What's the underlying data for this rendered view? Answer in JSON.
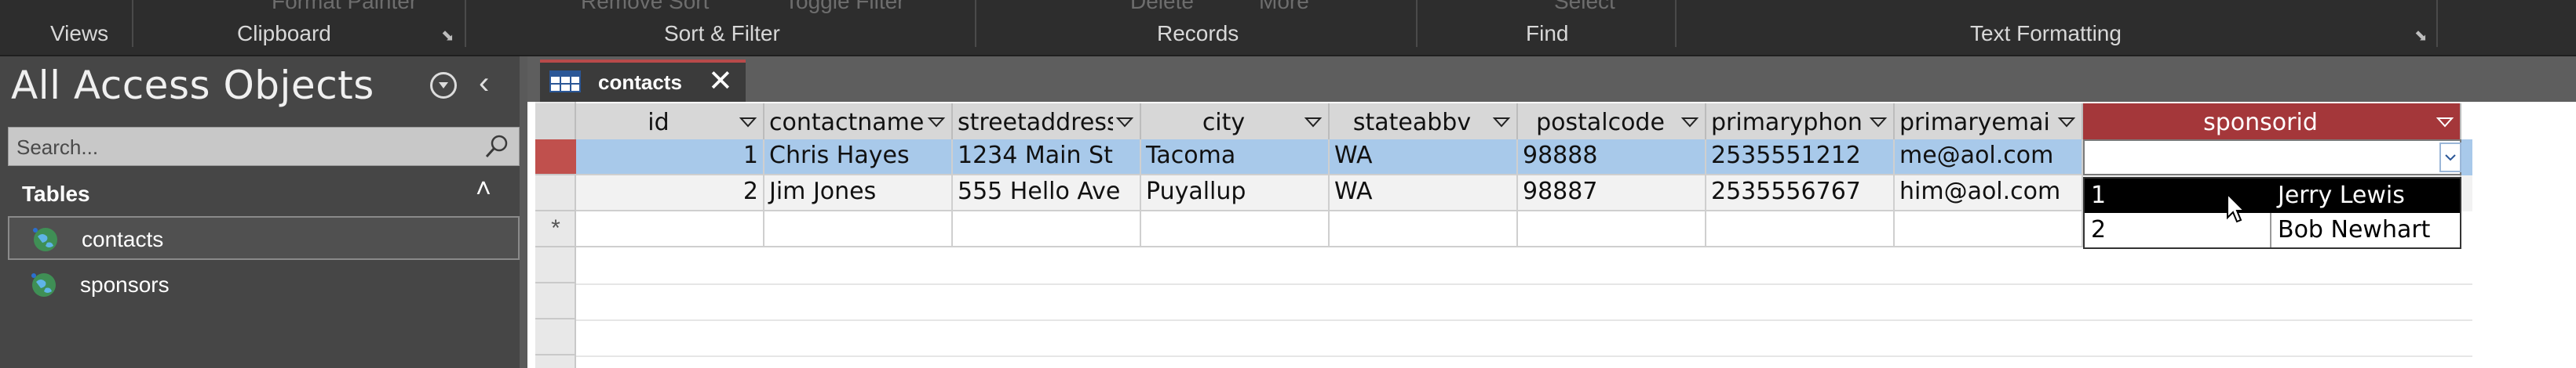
{
  "ribbon": {
    "top_items": [
      "Format Painter",
      "Remove Sort",
      "Toggle Filter",
      "Delete",
      "More",
      "Select"
    ],
    "groups": [
      "Views",
      "Clipboard",
      "Sort & Filter",
      "Records",
      "Find",
      "Text Formatting"
    ]
  },
  "nav": {
    "title": "All Access Objects",
    "search_placeholder": "Search...",
    "section_label": "Tables",
    "items": [
      {
        "label": "contacts",
        "selected": true
      },
      {
        "label": "sponsors",
        "selected": false
      }
    ]
  },
  "doc_tab": {
    "label": "contacts"
  },
  "datasheet": {
    "columns": [
      "id",
      "contactname",
      "streetaddress",
      "city",
      "stateabbv",
      "postalcode",
      "primaryphon",
      "primaryemai",
      "sponsorid"
    ],
    "active_column": "sponsorid",
    "rows": [
      [
        "1",
        "Chris Hayes",
        "1234 Main St",
        "Tacoma",
        "WA",
        "98888",
        "2535551212",
        "me@aol.com",
        ""
      ],
      [
        "2",
        "Jim Jones",
        "555 Hello Ave",
        "Puyallup",
        "WA",
        "98887",
        "2535556767",
        "him@aol.com",
        ""
      ]
    ],
    "new_row_marker": "*"
  },
  "sponsor_dropdown": {
    "options": [
      {
        "id": "1",
        "name": "Jerry Lewis",
        "highlighted": true
      },
      {
        "id": "2",
        "name": "Bob Newhart",
        "highlighted": false
      }
    ]
  },
  "colors": {
    "ribbon_bg": "#2d2d2d",
    "nav_bg": "#464646",
    "active_header": "#a4373a",
    "selected_row": "#a8c9ea",
    "accent_tab": "#b84a4a"
  }
}
